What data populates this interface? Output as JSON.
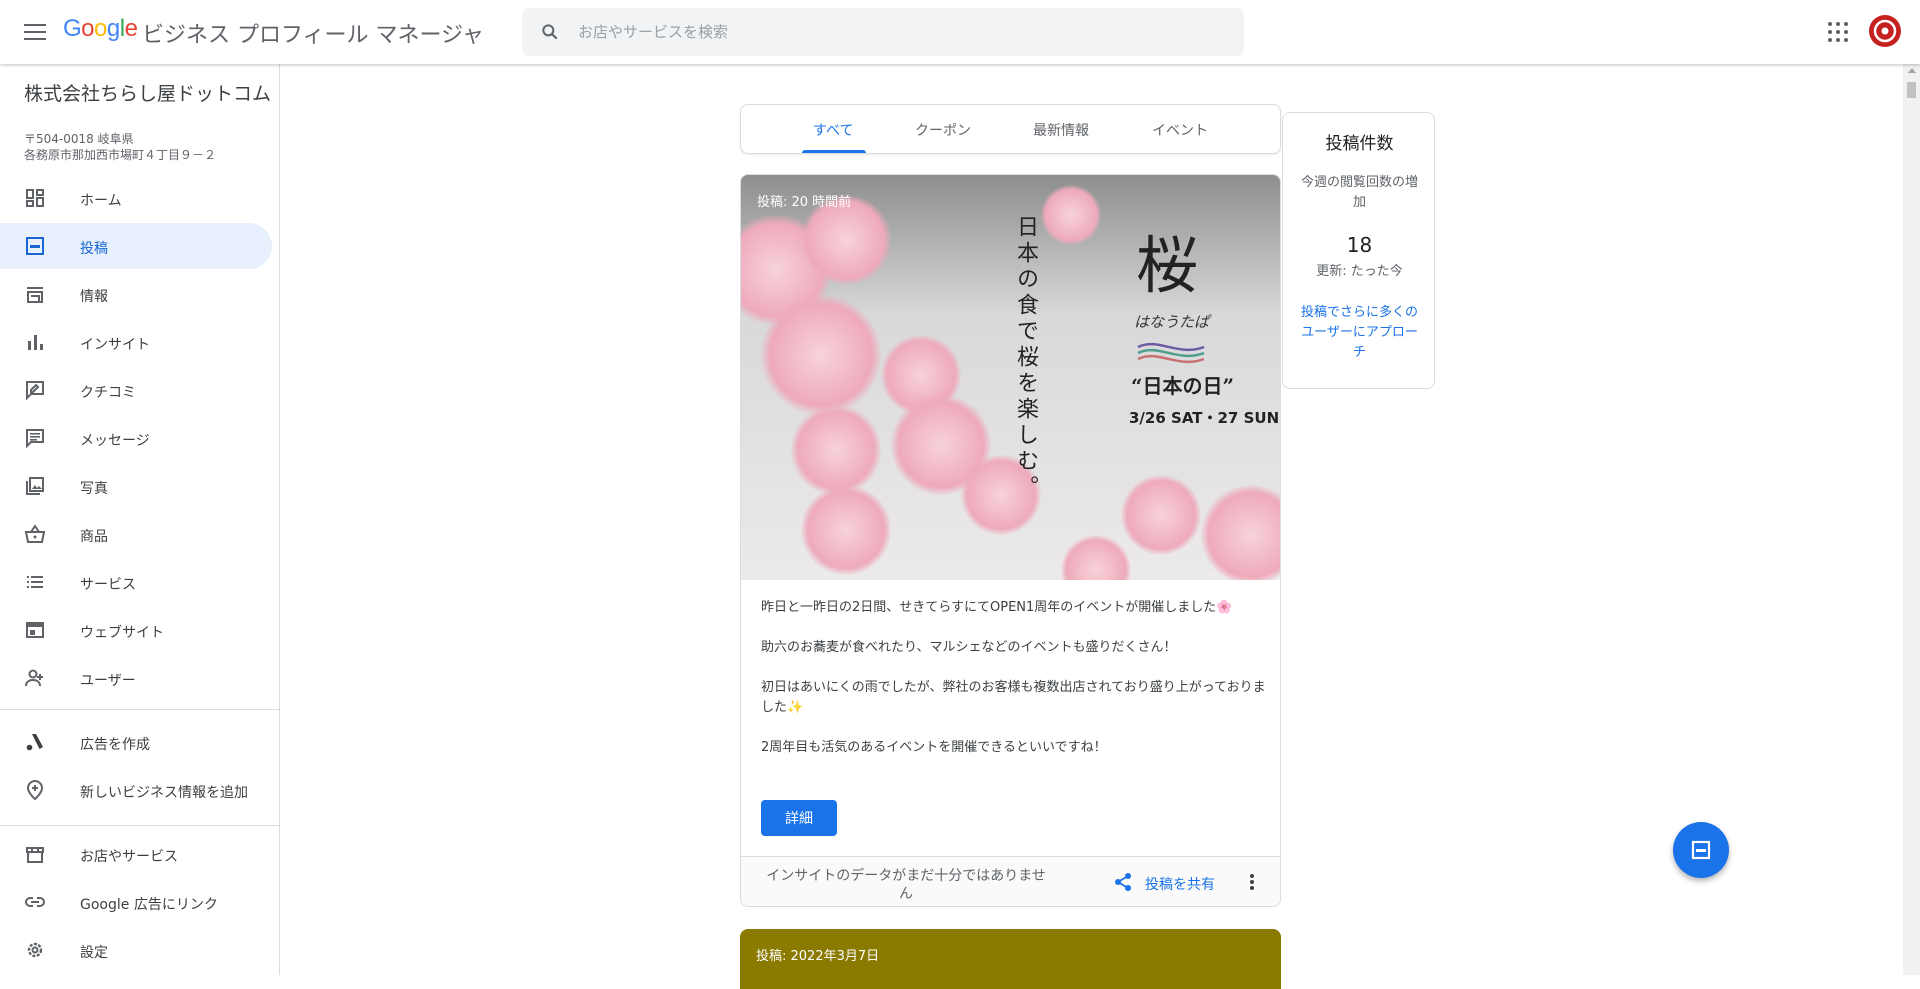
{
  "header": {
    "logo_text": "Google",
    "app_name": "ビジネス プロフィール マネージャ",
    "search_placeholder": "お店やサービスを検索"
  },
  "business": {
    "name": "株式会社ちらし屋ドットコム",
    "postal": "〒504-0018 岐阜県",
    "address": "各務原市那加西市場町４丁目９－２"
  },
  "sidebar": {
    "items": [
      {
        "label": "ホーム",
        "icon": "dashboard-icon"
      },
      {
        "label": "投稿",
        "icon": "posts-icon",
        "active": true
      },
      {
        "label": "情報",
        "icon": "storefront-icon"
      },
      {
        "label": "インサイト",
        "icon": "bar-chart-icon"
      },
      {
        "label": "クチコミ",
        "icon": "review-icon"
      },
      {
        "label": "メッセージ",
        "icon": "message-icon"
      },
      {
        "label": "写真",
        "icon": "photo-icon"
      },
      {
        "label": "商品",
        "icon": "basket-icon"
      },
      {
        "label": "サービス",
        "icon": "list-icon"
      },
      {
        "label": "ウェブサイト",
        "icon": "website-icon"
      },
      {
        "label": "ユーザー",
        "icon": "add-user-icon"
      }
    ],
    "secondary": [
      {
        "label": "広告を作成",
        "icon": "ads-icon"
      },
      {
        "label": "新しいビジネス情報を追加",
        "icon": "add-location-icon"
      }
    ],
    "tertiary": [
      {
        "label": "お店やサービス",
        "icon": "store-icon"
      },
      {
        "label": "Google 広告にリンク",
        "icon": "link-icon"
      },
      {
        "label": "設定",
        "icon": "gear-icon"
      }
    ]
  },
  "tabs": [
    {
      "label": "すべて",
      "active": true
    },
    {
      "label": "クーポン"
    },
    {
      "label": "最新情報"
    },
    {
      "label": "イベント"
    }
  ],
  "post": {
    "time": "投稿: 20 時間前",
    "image": {
      "vertical_text": "日本の食で桜を楽しむ。",
      "title": "桜",
      "subtitle": "はなうたぱ",
      "event_name": "“日本の日”",
      "dates": "3/26 SAT・27 SUN"
    },
    "body": [
      "昨日と一昨日の2日間、せきてらすにてOPEN1周年のイベントが開催しました🌸",
      "助六のお蕎麦が食べれたり、マルシェなどのイベントも盛りだくさん！",
      "初日はあいにくの雨でしたが、弊社のお客様も複数出店されており盛り上がっておりました✨",
      "2周年目も活気のあるイベントを開催できるといいですね！"
    ],
    "detail_label": "詳細",
    "insight_note": "インサイトのデータがまだ十分ではありません",
    "share_label": "投稿を共有"
  },
  "post2": {
    "time": "投稿: 2022年3月7日",
    "color": "#8a7a00"
  },
  "stats": {
    "title": "投稿件数",
    "desc": "今週の閲覧回数の増加",
    "value": "18",
    "updated": "更新: たった今",
    "link": "投稿でさらに多くのユーザーにアプローチ"
  },
  "colors": {
    "accent": "#1a73e8",
    "active_bg": "#e8f0fe"
  }
}
